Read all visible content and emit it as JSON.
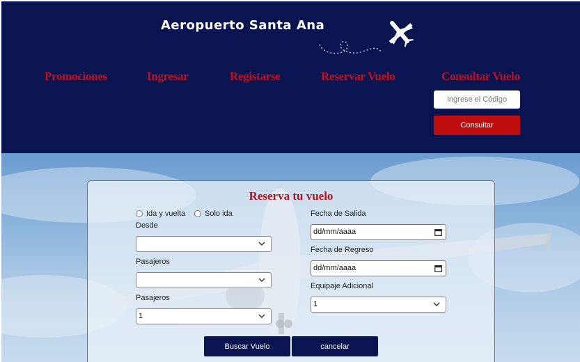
{
  "header": {
    "brand": "Aeropuerto Santa Ana",
    "nav": {
      "promociones": "Promociones",
      "ingresar": "Ingresar",
      "registrarse": "Registarse",
      "reservar": "Reservar Vuelo",
      "consultar": "Consultar Vuelo"
    },
    "code_placeholder": "Ingrese el Código",
    "consult_button": "Consultar"
  },
  "booking": {
    "title": "Reserva tu vuelo",
    "trip_options": [
      "Ida y vuelta",
      "Solo ida"
    ],
    "from_label": "Desde",
    "from_value": "",
    "passengers_label_1": "Pasajeros",
    "passengers_value_1": "",
    "passengers_label_2": "Pasajeros",
    "passengers_value_2": "1",
    "departure_label": "Fecha de Salida",
    "departure_value": "dd/mm/aaaa",
    "return_label": "Fecha de Regreso",
    "return_value": "dd/mm/aaaa",
    "luggage_label": "Equipaje Adicional",
    "luggage_value": "1",
    "search_button": "Buscar Vuelo",
    "cancel_button": "cancelar"
  },
  "colors": {
    "navy": "#0a1450",
    "red": "#c00d0d",
    "title_red": "#b0141c"
  }
}
